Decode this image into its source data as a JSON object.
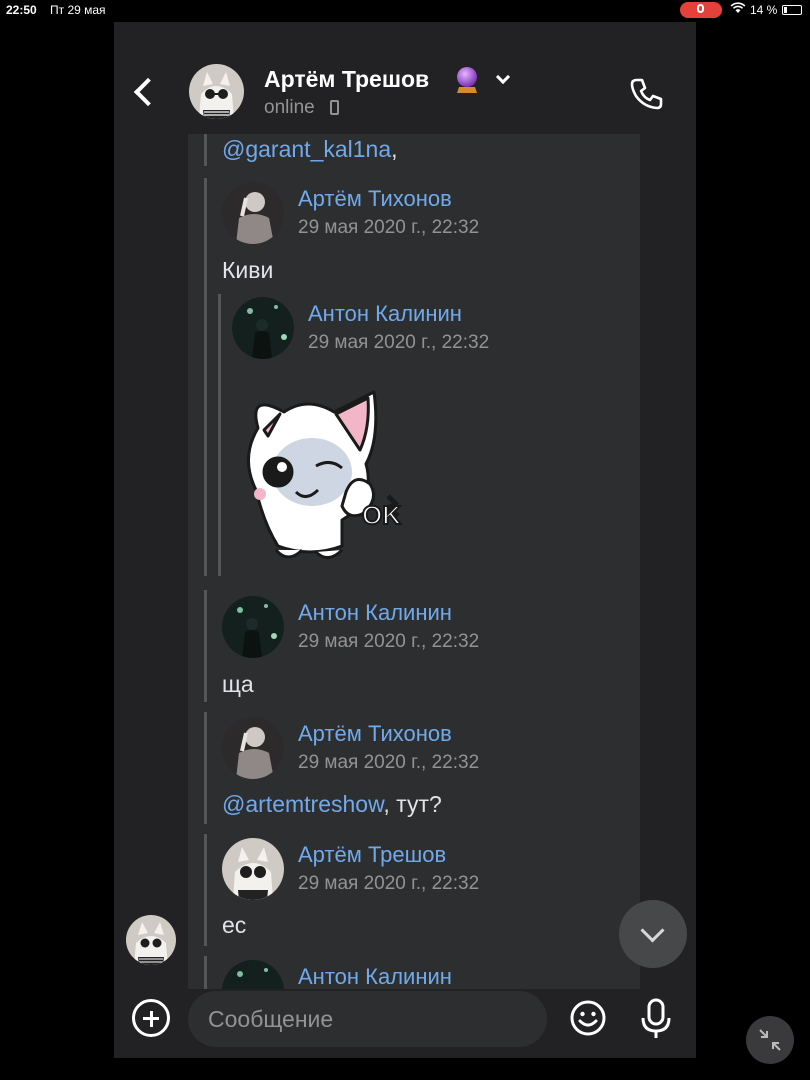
{
  "status_bar": {
    "time": "22:50",
    "date": "Пт 29 мая",
    "battery": "14 %"
  },
  "header": {
    "contact_name": "Артём Трешов",
    "status": "online",
    "icons": [
      "back-icon",
      "crystal-ball-emoji",
      "chevron-down-icon",
      "mobile-device-icon",
      "phone-icon"
    ]
  },
  "chat": {
    "top_mention": "@garant_kal1na",
    "top_mention_suffix": ",",
    "forwards": [
      {
        "author": "Артём Тихонов",
        "date": "29 мая 2020 г., 22:32",
        "text": "Киви"
      },
      {
        "author": "Антон Калинин",
        "date": "29 мая 2020 г., 22:32",
        "sticker": "white cat winking, OK hand"
      },
      {
        "author": "Антон Калинин",
        "date": "29 мая 2020 г., 22:32",
        "text": "ща"
      },
      {
        "author": "Артём Тихонов",
        "date": "29 мая 2020 г., 22:32",
        "mention": "@artemtreshow",
        "text_suffix": ", тут?"
      },
      {
        "author": "Артём Трешов",
        "date": "29 мая 2020 г., 22:32",
        "text": "ес"
      },
      {
        "author": "Антон Калинин"
      }
    ],
    "sticker_text": "OK"
  },
  "composer": {
    "placeholder": "Сообщение"
  },
  "colors": {
    "background": "#222224",
    "bubble": "#2d2e30",
    "link": "#71aaeb",
    "secondary_text": "#939393"
  }
}
